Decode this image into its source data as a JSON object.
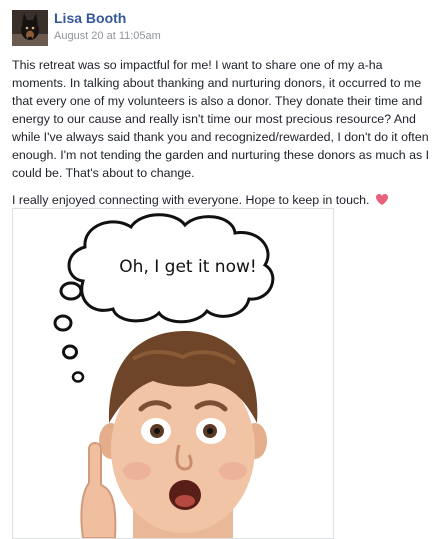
{
  "post": {
    "author": "Lisa Booth",
    "timestamp": "August 20 at 11:05am",
    "paragraphs": [
      "This retreat was so impactful for me! I want to share one of my a-ha moments. In talking about thanking and nurturing donors, it occurred to me that every one of my volunteers is also a donor. They donate their time and energy to our cause and really isn't time our most precious resource? And while I've always said thank you and recognized/rewarded, I don't do it often enough. I'm not tending the garden and nurturing these donors as much as I could be. That's about to change.",
      "I really enjoyed connecting with everyone. Hope to keep in touch."
    ],
    "emoji": "heart-emoji",
    "image": {
      "thought_bubble_text": "Oh, I get it now!"
    }
  },
  "colors": {
    "author_link": "#365899",
    "timestamp": "#90949c",
    "text": "#1d2129",
    "heart": "#e8607a"
  }
}
